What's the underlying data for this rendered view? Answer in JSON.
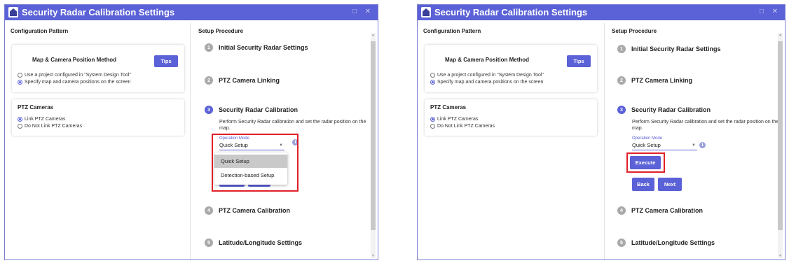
{
  "colors": {
    "accent": "#5b61d6",
    "highlight": "#e0202a",
    "inactive_step": "#a9a9a9"
  },
  "icons": {
    "app": "security-radar-app-icon",
    "maximize": "maximize-icon",
    "close": "close-icon",
    "info": "info-icon",
    "dropdown": "chevron-down-icon"
  },
  "screens": [
    {
      "title": "Security Radar Calibration Settings",
      "maximize_glyph": "□",
      "close_glyph": "✕",
      "config_heading": "Configuration Pattern",
      "setup_heading": "Setup Procedure",
      "method_card": {
        "title": "Map & Camera Position Method",
        "tips_label": "Tips",
        "options": [
          "Use a project configured in \"System Design Tool\"",
          "Specify map and camera positions on the screen"
        ],
        "selected": 1
      },
      "ptz_card": {
        "title": "PTZ Cameras",
        "options": [
          "Link PTZ Cameras",
          "Do Not Link PTZ Cameras"
        ],
        "selected": 0
      },
      "steps": [
        {
          "number": "1",
          "label": "Initial Security Radar Settings",
          "state": "done"
        },
        {
          "number": "2",
          "label": "PTZ Camera Linking",
          "state": "done"
        },
        {
          "number": "3",
          "label": "Security Radar Calibration",
          "state": "active"
        },
        {
          "number": "4",
          "label": "PTZ Camera Calibration",
          "state": "pending"
        },
        {
          "number": "5",
          "label": "Latitude/Longitude Settings",
          "state": "pending"
        }
      ],
      "step3_description": "Perform Security Radar calibration and set the radar position on the map.",
      "operation_mode_label": "Operation Mode",
      "operation_mode_value": "Quick Setup",
      "info_glyph": "i",
      "caret_glyph": "▼",
      "dropdown_open": true,
      "dropdown_options": [
        "Quick Setup",
        "Detection-based Setup"
      ],
      "dropdown_selected": 0,
      "scroll_up": "▲",
      "scroll_down": "▼"
    },
    {
      "title": "Security Radar Calibration Settings",
      "maximize_glyph": "□",
      "close_glyph": "✕",
      "config_heading": "Configuration Pattern",
      "setup_heading": "Setup Procedure",
      "method_card": {
        "title": "Map & Camera Position Method",
        "tips_label": "Tips",
        "options": [
          "Use a project configured in \"System Design Tool\"",
          "Specify map and camera positions on the screen"
        ],
        "selected": 1
      },
      "ptz_card": {
        "title": "PTZ Cameras",
        "options": [
          "Link PTZ Cameras",
          "Do Not Link PTZ Cameras"
        ],
        "selected": 0
      },
      "steps": [
        {
          "number": "1",
          "label": "Initial Security Radar Settings",
          "state": "done"
        },
        {
          "number": "2",
          "label": "PTZ Camera Linking",
          "state": "done"
        },
        {
          "number": "3",
          "label": "Security Radar Calibration",
          "state": "active"
        },
        {
          "number": "4",
          "label": "PTZ Camera Calibration",
          "state": "pending"
        },
        {
          "number": "5",
          "label": "Latitude/Longitude Settings",
          "state": "pending"
        }
      ],
      "step3_description": "Perform Security Radar calibration and set the radar position on the map.",
      "operation_mode_label": "Operation Mode",
      "operation_mode_value": "Quick Setup",
      "info_glyph": "i",
      "caret_glyph": "▼",
      "execute_label": "Execute",
      "back_label": "Back",
      "next_label": "Next",
      "scroll_up": "▲",
      "scroll_down": "▼"
    }
  ]
}
